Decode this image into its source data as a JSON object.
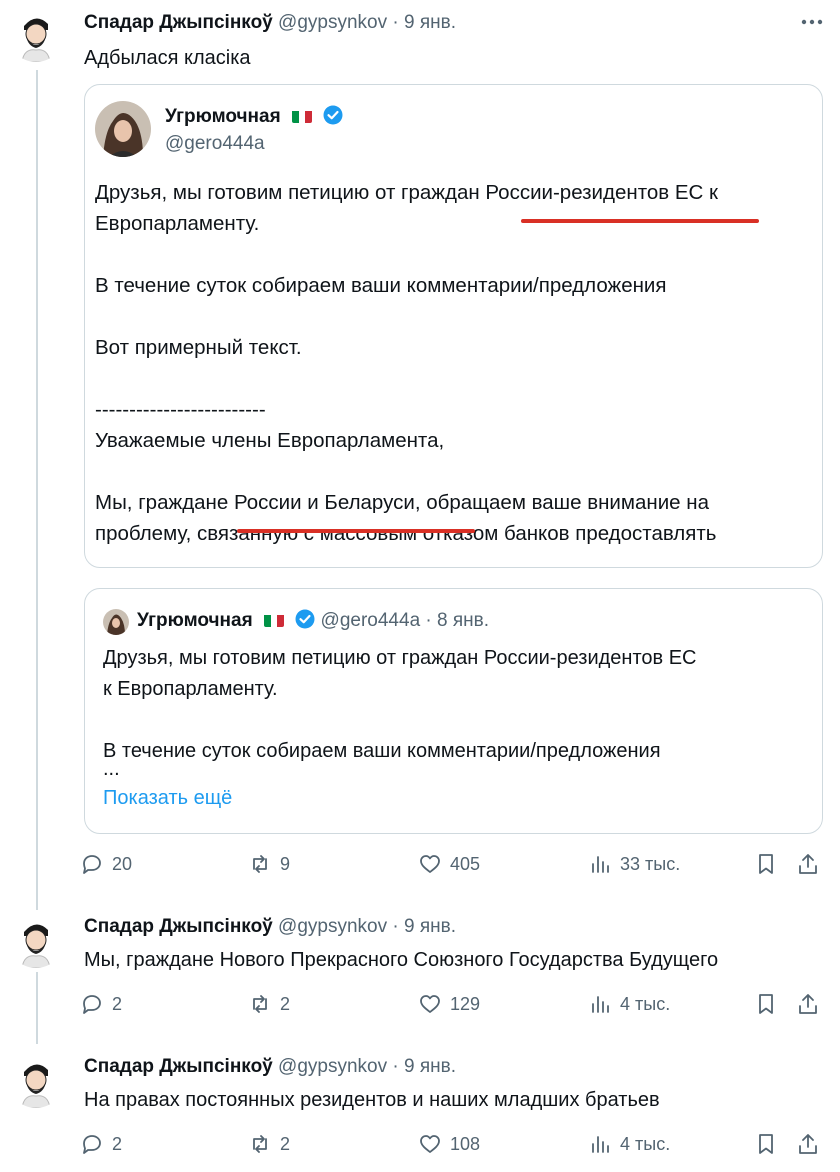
{
  "tweet1": {
    "name": "Спадар Джыпсінкоў",
    "handle": "@gypsynkov",
    "separator": "·",
    "date": "9 янв.",
    "text": "Адбылася класіка",
    "quote": {
      "name": "Угрюмочная",
      "handle": "@gero444a",
      "line1": "Друзья, мы готовим петицию от граждан России-резидентов ЕС к",
      "line2": "Европарламенту.",
      "line3": "В течение суток собираем ваши комментарии/предложения",
      "line4": "Вот примерный текст.",
      "line5": "-------------------------",
      "line6": "Уважаемые члены Европарламента,",
      "line7": "Мы, граждане России и Беларуси, обращаем ваше внимание на",
      "line8": "проблему, связанную с массовым отказом банков предоставлять"
    },
    "inner_quote": {
      "name": "Угрюмочная",
      "handle": "@gero444a",
      "separator": "·",
      "date": "8 янв.",
      "line1": "Друзья, мы готовим петицию от граждан России-резидентов ЕС",
      "line2": "к Европарламенту.",
      "line3": "В течение суток собираем ваши комментарии/предложения",
      "line4": "...",
      "show_more": "Показать ещё"
    },
    "stats": {
      "replies": "20",
      "reposts": "9",
      "likes": "405",
      "views": "33 тыс."
    }
  },
  "tweet2": {
    "name": "Спадар Джыпсінкоў",
    "handle": "@gypsynkov",
    "separator": "·",
    "date": "9 янв.",
    "text": "Мы, граждане Нового Прекрасного Союзного Государства Будущего",
    "stats": {
      "replies": "2",
      "reposts": "2",
      "likes": "129",
      "views": "4 тыс."
    }
  },
  "tweet3": {
    "name": "Спадар Джыпсінкоў",
    "handle": "@gypsynkov",
    "separator": "·",
    "date": "9 янв.",
    "text": "На правах постоянных резидентов и наших младших братьев",
    "stats": {
      "replies": "2",
      "reposts": "2",
      "likes": "108",
      "views": "4 тыс."
    }
  },
  "colors": {
    "underline": "#d93025",
    "link": "#1d9bf0",
    "muted": "#536471",
    "border": "#cfd9de",
    "verified": "#1d9bf0"
  },
  "icons": [
    "more-icon",
    "reply-icon",
    "repost-icon",
    "like-icon",
    "views-icon",
    "bookmark-icon",
    "share-icon",
    "verified-badge-icon",
    "italy-flag-icon"
  ]
}
